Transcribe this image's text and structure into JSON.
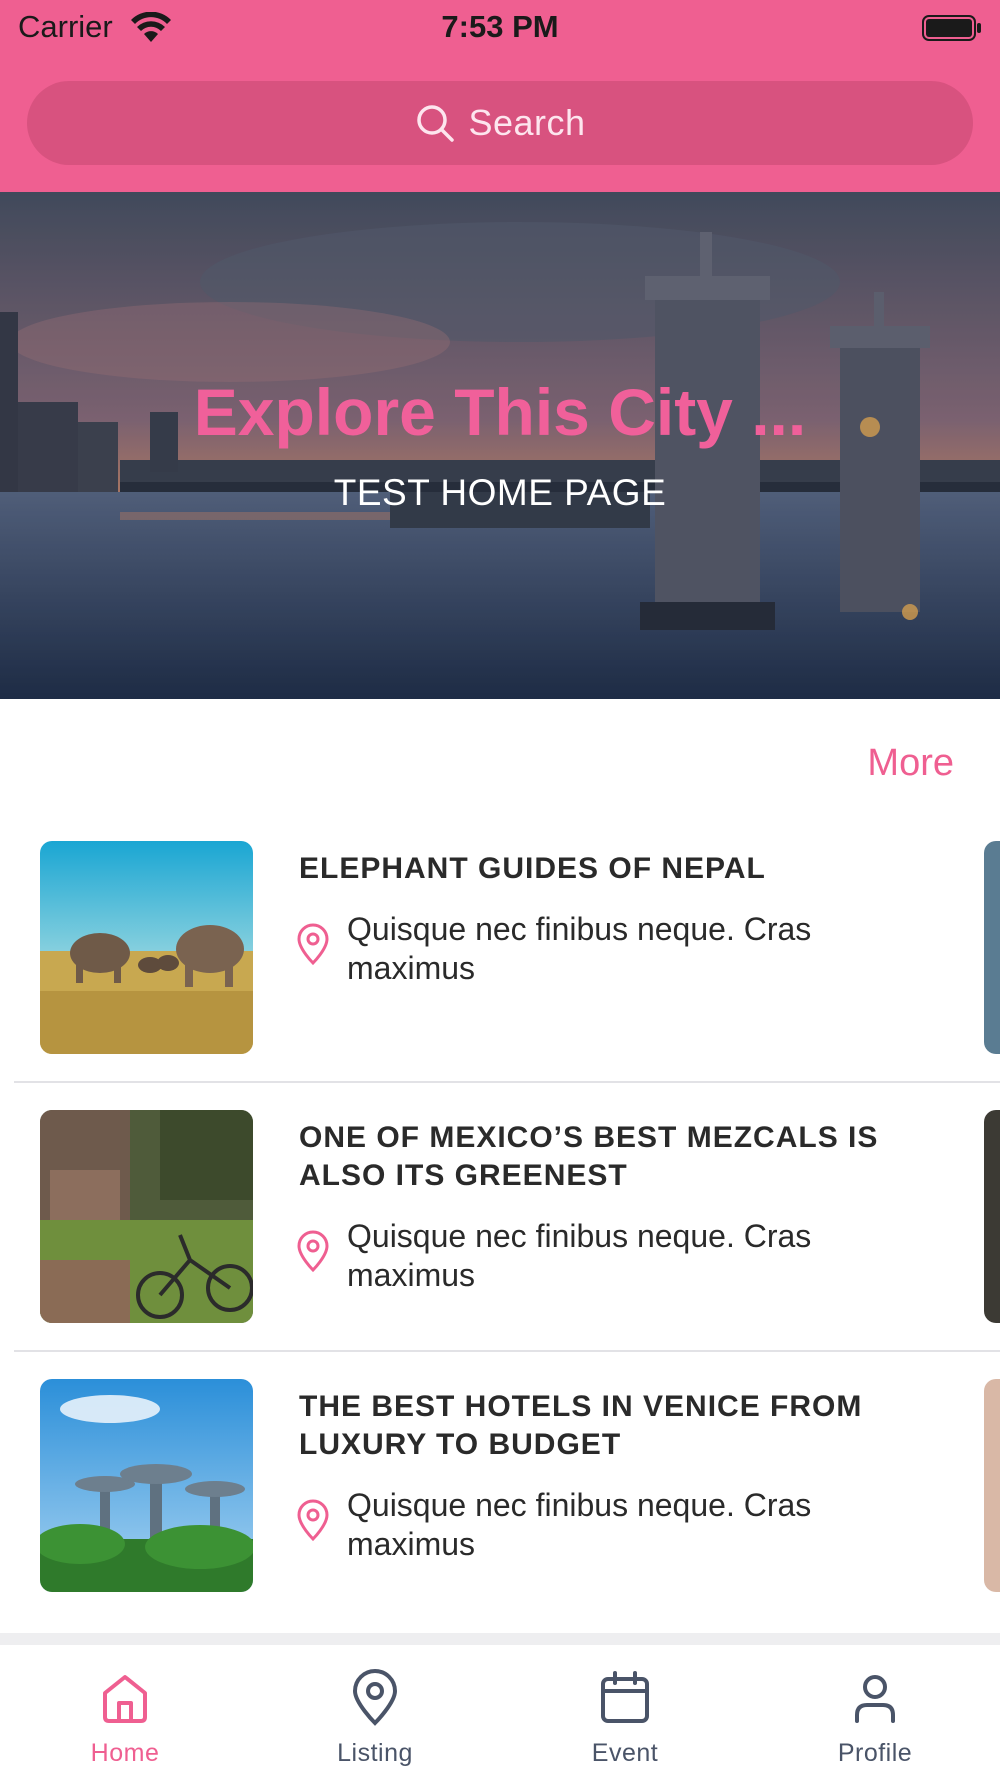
{
  "status_bar": {
    "carrier": "Carrier",
    "time": "7:53 PM"
  },
  "search": {
    "placeholder": "Search"
  },
  "hero": {
    "title": "Explore This City ...",
    "subtitle": "TEST HOME PAGE"
  },
  "more_label": "More",
  "items": [
    {
      "title": "ELEPHANT GUIDES OF NEPAL",
      "location": "Quisque nec finibus neque. Cras maximus"
    },
    {
      "title": "ONE OF MEXICO’S BEST MEZCALS IS ALSO ITS GREENEST",
      "location": "Quisque nec finibus neque. Cras maximus"
    },
    {
      "title": "THE BEST HOTELS IN VENICE FROM LUXURY TO BUDGET",
      "location": "Quisque nec finibus neque. Cras maximus"
    }
  ],
  "tabs": [
    {
      "label": "Home",
      "icon": "home-icon",
      "active": true
    },
    {
      "label": "Listing",
      "icon": "map-pin-icon"
    },
    {
      "label": "Event",
      "icon": "calendar-icon"
    },
    {
      "label": "Profile",
      "icon": "user-icon"
    }
  ],
  "colors": {
    "accent": "#ef5f91",
    "search_bg": "#d8527f",
    "tab_inactive": "#4a5468"
  }
}
